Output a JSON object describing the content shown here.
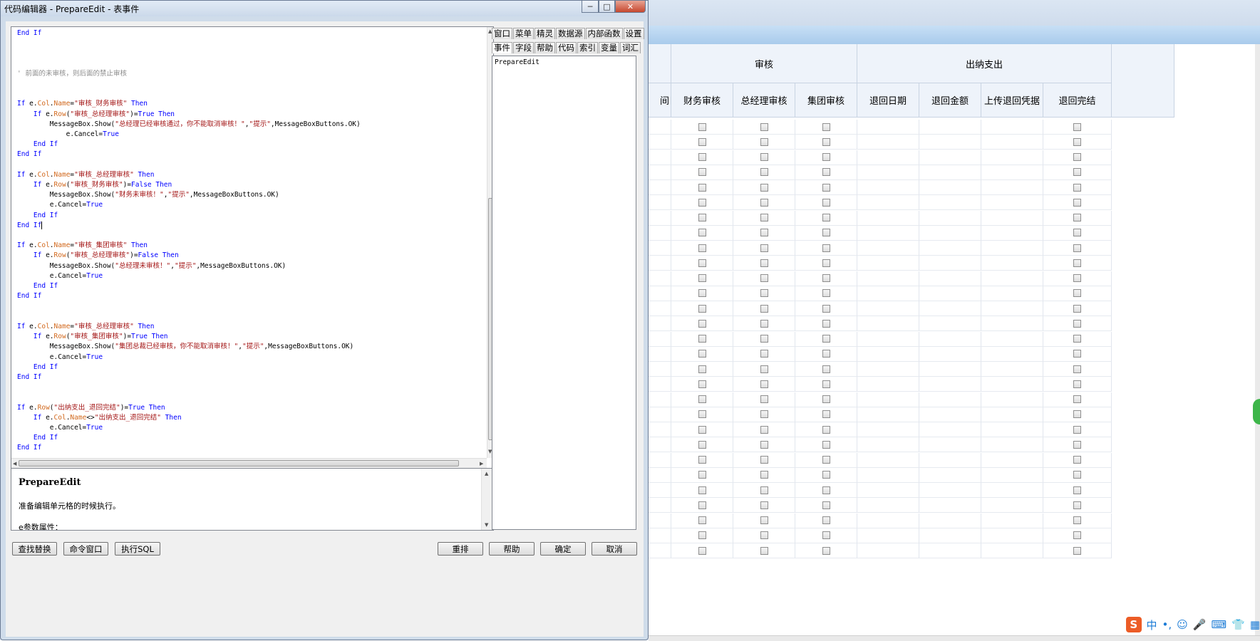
{
  "window": {
    "title": "代码编辑器 - PrepareEdit - 表事件",
    "minimize_symbol": "─",
    "maximize_symbol": "□",
    "close_symbol": "✕"
  },
  "code_lines": [
    [
      {
        "t": "End If",
        "c": "kw"
      }
    ],
    [],
    [],
    [],
    [
      {
        "t": "' 前面的未审核，则后面的禁止审核",
        "c": "cmt"
      }
    ],
    [],
    [],
    [
      {
        "t": "If ",
        "c": "kw"
      },
      {
        "t": "e."
      },
      {
        "t": "Col",
        "c": "prop"
      },
      {
        "t": "."
      },
      {
        "t": "Name",
        "c": "prop"
      },
      {
        "t": "="
      },
      {
        "t": "\"审核_财务审核\"",
        "c": "str"
      },
      {
        "t": " Then",
        "c": "kw"
      }
    ],
    [
      {
        "t": "    "
      },
      {
        "t": "If ",
        "c": "kw"
      },
      {
        "t": "e."
      },
      {
        "t": "Row",
        "c": "prop"
      },
      {
        "t": "("
      },
      {
        "t": "\"审核_总经理审核\"",
        "c": "str"
      },
      {
        "t": ")="
      },
      {
        "t": "True Then",
        "c": "kw"
      }
    ],
    [
      {
        "t": "        MessageBox.Show("
      },
      {
        "t": "\"总经理已经审核通过，你不能取消审核！\"",
        "c": "str"
      },
      {
        "t": ","
      },
      {
        "t": "\"提示\"",
        "c": "str"
      },
      {
        "t": ",MessageBoxButtons.OK)"
      }
    ],
    [
      {
        "t": "            e.Cancel="
      },
      {
        "t": "True",
        "c": "kw"
      }
    ],
    [
      {
        "t": "    "
      },
      {
        "t": "End If",
        "c": "kw"
      }
    ],
    [
      {
        "t": "End If",
        "c": "kw"
      }
    ],
    [],
    [
      {
        "t": "If ",
        "c": "kw"
      },
      {
        "t": "e."
      },
      {
        "t": "Col",
        "c": "prop"
      },
      {
        "t": "."
      },
      {
        "t": "Name",
        "c": "prop"
      },
      {
        "t": "="
      },
      {
        "t": "\"审核_总经理审核\"",
        "c": "str"
      },
      {
        "t": " Then",
        "c": "kw"
      }
    ],
    [
      {
        "t": "    "
      },
      {
        "t": "If ",
        "c": "kw"
      },
      {
        "t": "e."
      },
      {
        "t": "Row",
        "c": "prop"
      },
      {
        "t": "("
      },
      {
        "t": "\"审核_财务审核\"",
        "c": "str"
      },
      {
        "t": ")="
      },
      {
        "t": "False Then",
        "c": "kw"
      }
    ],
    [
      {
        "t": "        MessageBox.Show("
      },
      {
        "t": "\"财务未审核！\"",
        "c": "str"
      },
      {
        "t": ","
      },
      {
        "t": "\"提示\"",
        "c": "str"
      },
      {
        "t": ",MessageBoxButtons.OK)"
      }
    ],
    [
      {
        "t": "        e.Cancel="
      },
      {
        "t": "True",
        "c": "kw"
      }
    ],
    [
      {
        "t": "    "
      },
      {
        "t": "End If",
        "c": "kw"
      }
    ],
    [
      {
        "t": "End I",
        "c": "kw"
      },
      {
        "t": "f",
        "c": "kw caret"
      }
    ],
    [],
    [
      {
        "t": "If ",
        "c": "kw"
      },
      {
        "t": "e."
      },
      {
        "t": "Col",
        "c": "prop"
      },
      {
        "t": "."
      },
      {
        "t": "Name",
        "c": "prop"
      },
      {
        "t": "="
      },
      {
        "t": "\"审核_集团审核\"",
        "c": "str"
      },
      {
        "t": " Then",
        "c": "kw"
      }
    ],
    [
      {
        "t": "    "
      },
      {
        "t": "If ",
        "c": "kw"
      },
      {
        "t": "e."
      },
      {
        "t": "Row",
        "c": "prop"
      },
      {
        "t": "("
      },
      {
        "t": "\"审核_总经理审核\"",
        "c": "str"
      },
      {
        "t": ")="
      },
      {
        "t": "False Then",
        "c": "kw"
      }
    ],
    [
      {
        "t": "        MessageBox.Show("
      },
      {
        "t": "\"总经理未审核！\"",
        "c": "str"
      },
      {
        "t": ","
      },
      {
        "t": "\"提示\"",
        "c": "str"
      },
      {
        "t": ",MessageBoxButtons.OK)"
      }
    ],
    [
      {
        "t": "        e.Cancel="
      },
      {
        "t": "True",
        "c": "kw"
      }
    ],
    [
      {
        "t": "    "
      },
      {
        "t": "End If",
        "c": "kw"
      }
    ],
    [
      {
        "t": "End If",
        "c": "kw"
      }
    ],
    [],
    [],
    [
      {
        "t": "If ",
        "c": "kw"
      },
      {
        "t": "e."
      },
      {
        "t": "Col",
        "c": "prop"
      },
      {
        "t": "."
      },
      {
        "t": "Name",
        "c": "prop"
      },
      {
        "t": "="
      },
      {
        "t": "\"审核_总经理审核\"",
        "c": "str"
      },
      {
        "t": " Then",
        "c": "kw"
      }
    ],
    [
      {
        "t": "    "
      },
      {
        "t": "If ",
        "c": "kw"
      },
      {
        "t": "e."
      },
      {
        "t": "Row",
        "c": "prop"
      },
      {
        "t": "("
      },
      {
        "t": "\"审核_集团审核\"",
        "c": "str"
      },
      {
        "t": ")="
      },
      {
        "t": "True Then",
        "c": "kw"
      }
    ],
    [
      {
        "t": "        MessageBox.Show("
      },
      {
        "t": "\"集团总裁已经审核，你不能取消审核！\"",
        "c": "str"
      },
      {
        "t": ","
      },
      {
        "t": "\"提示\"",
        "c": "str"
      },
      {
        "t": ",MessageBoxButtons.OK)"
      }
    ],
    [
      {
        "t": "        e.Cancel="
      },
      {
        "t": "True",
        "c": "kw"
      }
    ],
    [
      {
        "t": "    "
      },
      {
        "t": "End If",
        "c": "kw"
      }
    ],
    [
      {
        "t": "End If",
        "c": "kw"
      }
    ],
    [],
    [],
    [
      {
        "t": "If ",
        "c": "kw"
      },
      {
        "t": "e."
      },
      {
        "t": "Row",
        "c": "prop"
      },
      {
        "t": "("
      },
      {
        "t": "\"出纳支出_退回完结\"",
        "c": "str"
      },
      {
        "t": ")="
      },
      {
        "t": "True Then",
        "c": "kw"
      }
    ],
    [
      {
        "t": "    "
      },
      {
        "t": "If ",
        "c": "kw"
      },
      {
        "t": "e."
      },
      {
        "t": "Col",
        "c": "prop"
      },
      {
        "t": "."
      },
      {
        "t": "Name",
        "c": "prop"
      },
      {
        "t": "<>"
      },
      {
        "t": "\"出纳支出_退回完结\"",
        "c": "str"
      },
      {
        "t": " Then",
        "c": "kw"
      }
    ],
    [
      {
        "t": "        e.Cancel="
      },
      {
        "t": "True",
        "c": "kw"
      }
    ],
    [
      {
        "t": "    "
      },
      {
        "t": "End If",
        "c": "kw"
      }
    ],
    [
      {
        "t": "End If",
        "c": "kw"
      }
    ]
  ],
  "help": {
    "title": "PrepareEdit",
    "description": "准备编辑单元格的时候执行。",
    "params_label": "e参数属性："
  },
  "tabs_row1": [
    "窗口",
    "菜单",
    "精灵",
    "数据源",
    "内部函数",
    "设置"
  ],
  "tabs_row2": [
    "事件",
    "字段",
    "帮助",
    "代码",
    "索引",
    "变量",
    "词汇"
  ],
  "active_tab": "事件",
  "event_list": [
    "PrepareEdit"
  ],
  "buttons": {
    "find_replace": "查找替换",
    "command_window": "命令窗口",
    "execute_sql": "执行SQL",
    "rearrange": "重排",
    "help": "帮助",
    "ok": "确定",
    "cancel": "取消"
  },
  "grid": {
    "groups": [
      {
        "label": "审核"
      },
      {
        "label": "出纳支出"
      }
    ],
    "partial_column_label": "间",
    "columns": [
      {
        "label": "财务审核",
        "checkbox": true
      },
      {
        "label": "总经理审核",
        "checkbox": true
      },
      {
        "label": "集团审核",
        "checkbox": true
      },
      {
        "label": "退回日期",
        "checkbox": false
      },
      {
        "label": "退回金额",
        "checkbox": false
      },
      {
        "label": "上传退回凭据",
        "checkbox": false
      },
      {
        "label": "退回完结",
        "checkbox": true
      }
    ],
    "row_count": 29
  },
  "ime": {
    "logo": "S",
    "mode": "中",
    "punct": "•,",
    "icons": [
      "☺",
      "🎤",
      "⌨",
      "👕",
      "▦"
    ]
  }
}
